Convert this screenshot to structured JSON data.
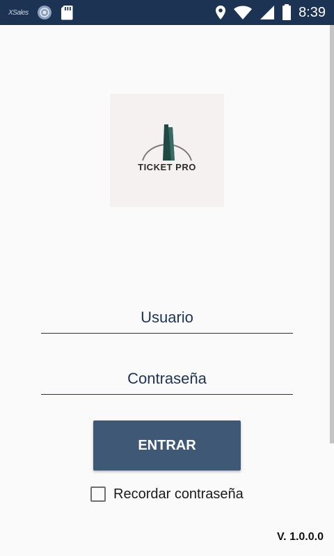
{
  "status_bar": {
    "app_tag": "XSales",
    "time": "8:39",
    "icons": [
      "xsales-logo-icon",
      "globe-icon",
      "sd-card-icon",
      "location-icon",
      "wifi-icon",
      "cell-signal-icon",
      "battery-icon"
    ]
  },
  "logo": {
    "text": "TICKET PRO"
  },
  "login": {
    "username_placeholder": "Usuario",
    "password_placeholder": "Contraseña",
    "submit_label": "ENTRAR",
    "remember_label": "Recordar contraseña",
    "remember_checked": false
  },
  "footer": {
    "version": "V. 1.0.0.0"
  },
  "colors": {
    "status_bar": "#1d3354",
    "primary": "#3e5876",
    "text_accent": "#1d3354",
    "background": "#fafafa"
  }
}
